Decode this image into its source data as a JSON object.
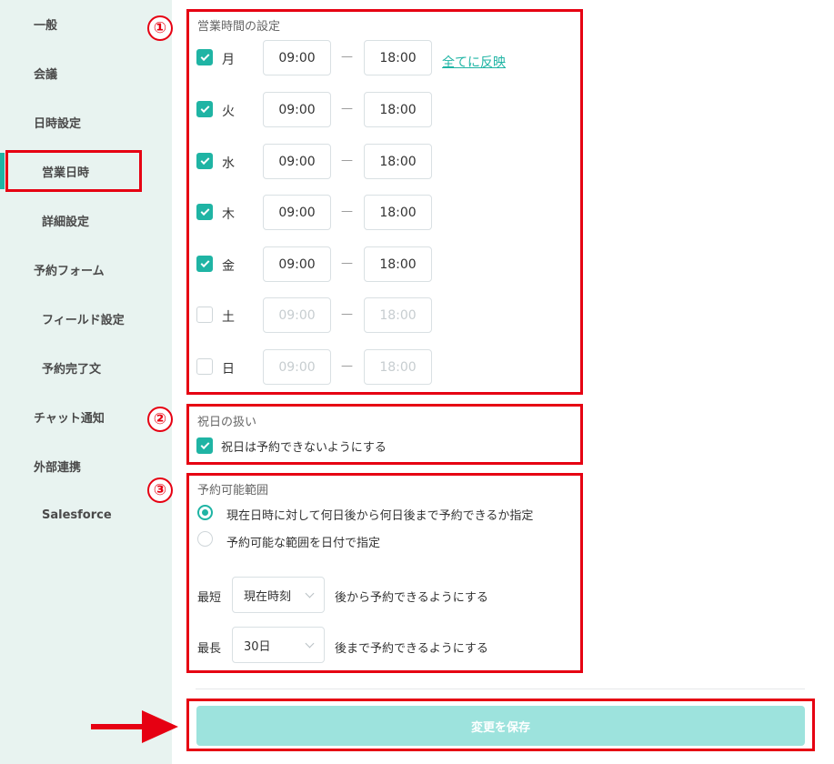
{
  "sidebar": {
    "items": [
      {
        "label": "一般"
      },
      {
        "label": "会議"
      },
      {
        "label": "日時設定"
      },
      {
        "label": "営業日時"
      },
      {
        "label": "詳細設定"
      },
      {
        "label": "予約フォーム"
      },
      {
        "label": "フィールド設定"
      },
      {
        "label": "予約完了文"
      },
      {
        "label": "チャット通知"
      },
      {
        "label": "外部連携"
      },
      {
        "label": "Salesforce"
      }
    ]
  },
  "annotations": {
    "one": "①",
    "two": "②",
    "three": "③"
  },
  "hours": {
    "title": "営業時間の設定",
    "separator": "—",
    "reflect_all": "全てに反映",
    "days": [
      {
        "label": "月",
        "checked": true,
        "start": "09:00",
        "end": "18:00"
      },
      {
        "label": "火",
        "checked": true,
        "start": "09:00",
        "end": "18:00"
      },
      {
        "label": "水",
        "checked": true,
        "start": "09:00",
        "end": "18:00"
      },
      {
        "label": "木",
        "checked": true,
        "start": "09:00",
        "end": "18:00"
      },
      {
        "label": "金",
        "checked": true,
        "start": "09:00",
        "end": "18:00"
      },
      {
        "label": "土",
        "checked": false,
        "start": "09:00",
        "end": "18:00"
      },
      {
        "label": "日",
        "checked": false,
        "start": "09:00",
        "end": "18:00"
      }
    ]
  },
  "holiday": {
    "title": "祝日の扱い",
    "checkbox_label": "祝日は予約できないようにする",
    "checked": true
  },
  "range": {
    "title": "予約可能範囲",
    "option1": "現在日時に対して何日後から何日後まで予約できるか指定",
    "option2": "予約可能な範囲を日付で指定",
    "min_label": "最短",
    "min_value": "現在時刻",
    "min_suffix": "後から予約できるようにする",
    "max_label": "最長",
    "max_value": "30日",
    "max_suffix": "後まで予約できるようにする"
  },
  "save_label": "変更を保存",
  "colors": {
    "accent": "#1fb4a4",
    "annotation": "#e60012",
    "sidebar_bg": "#e8f3f0",
    "save_bg": "#9de3dd"
  }
}
